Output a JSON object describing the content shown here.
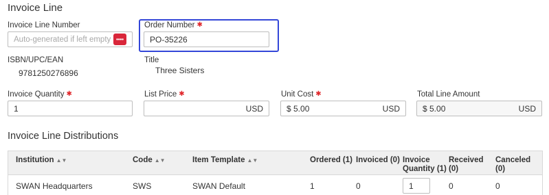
{
  "invoice_line": {
    "heading": "Invoice Line",
    "line_number": {
      "label": "Invoice Line Number",
      "placeholder": "Auto-generated if left empty"
    },
    "order_number": {
      "label": "Order Number",
      "value": "PO-35226"
    },
    "isbn": {
      "label": "ISBN/UPC/EAN",
      "value": "9781250276896"
    },
    "title": {
      "label": "Title",
      "value": "Three Sisters"
    },
    "invoice_quantity": {
      "label": "Invoice Quantity",
      "value": "1"
    },
    "list_price": {
      "label": "List Price",
      "value": "",
      "currency": "USD"
    },
    "unit_cost": {
      "label": "Unit Cost",
      "value": "$ 5.00",
      "currency": "USD"
    },
    "total_line_amount": {
      "label": "Total Line Amount",
      "value": "$ 5.00",
      "currency": "USD"
    }
  },
  "distributions": {
    "heading": "Invoice Line Distributions",
    "columns": {
      "institution": "Institution",
      "code": "Code",
      "item_template": "Item Template",
      "ordered": "Ordered (1)",
      "invoiced": "Invoiced (0)",
      "invoice_quantity_line1": "Invoice",
      "invoice_quantity_line2": "Quantity (1)",
      "received_line1": "Received",
      "received_line2": "(0)",
      "canceled_line1": "Canceled",
      "canceled_line2": "(0)"
    },
    "rows": [
      {
        "institution": "SWAN Headquarters",
        "code": "SWS",
        "item_template": "SWAN Default",
        "ordered": "1",
        "invoiced": "0",
        "invoice_quantity": "1",
        "received": "0",
        "canceled": "0"
      }
    ]
  },
  "colors": {
    "required": "#e0262a",
    "focus": "#3346d8",
    "generate_button": "#d9263a"
  }
}
